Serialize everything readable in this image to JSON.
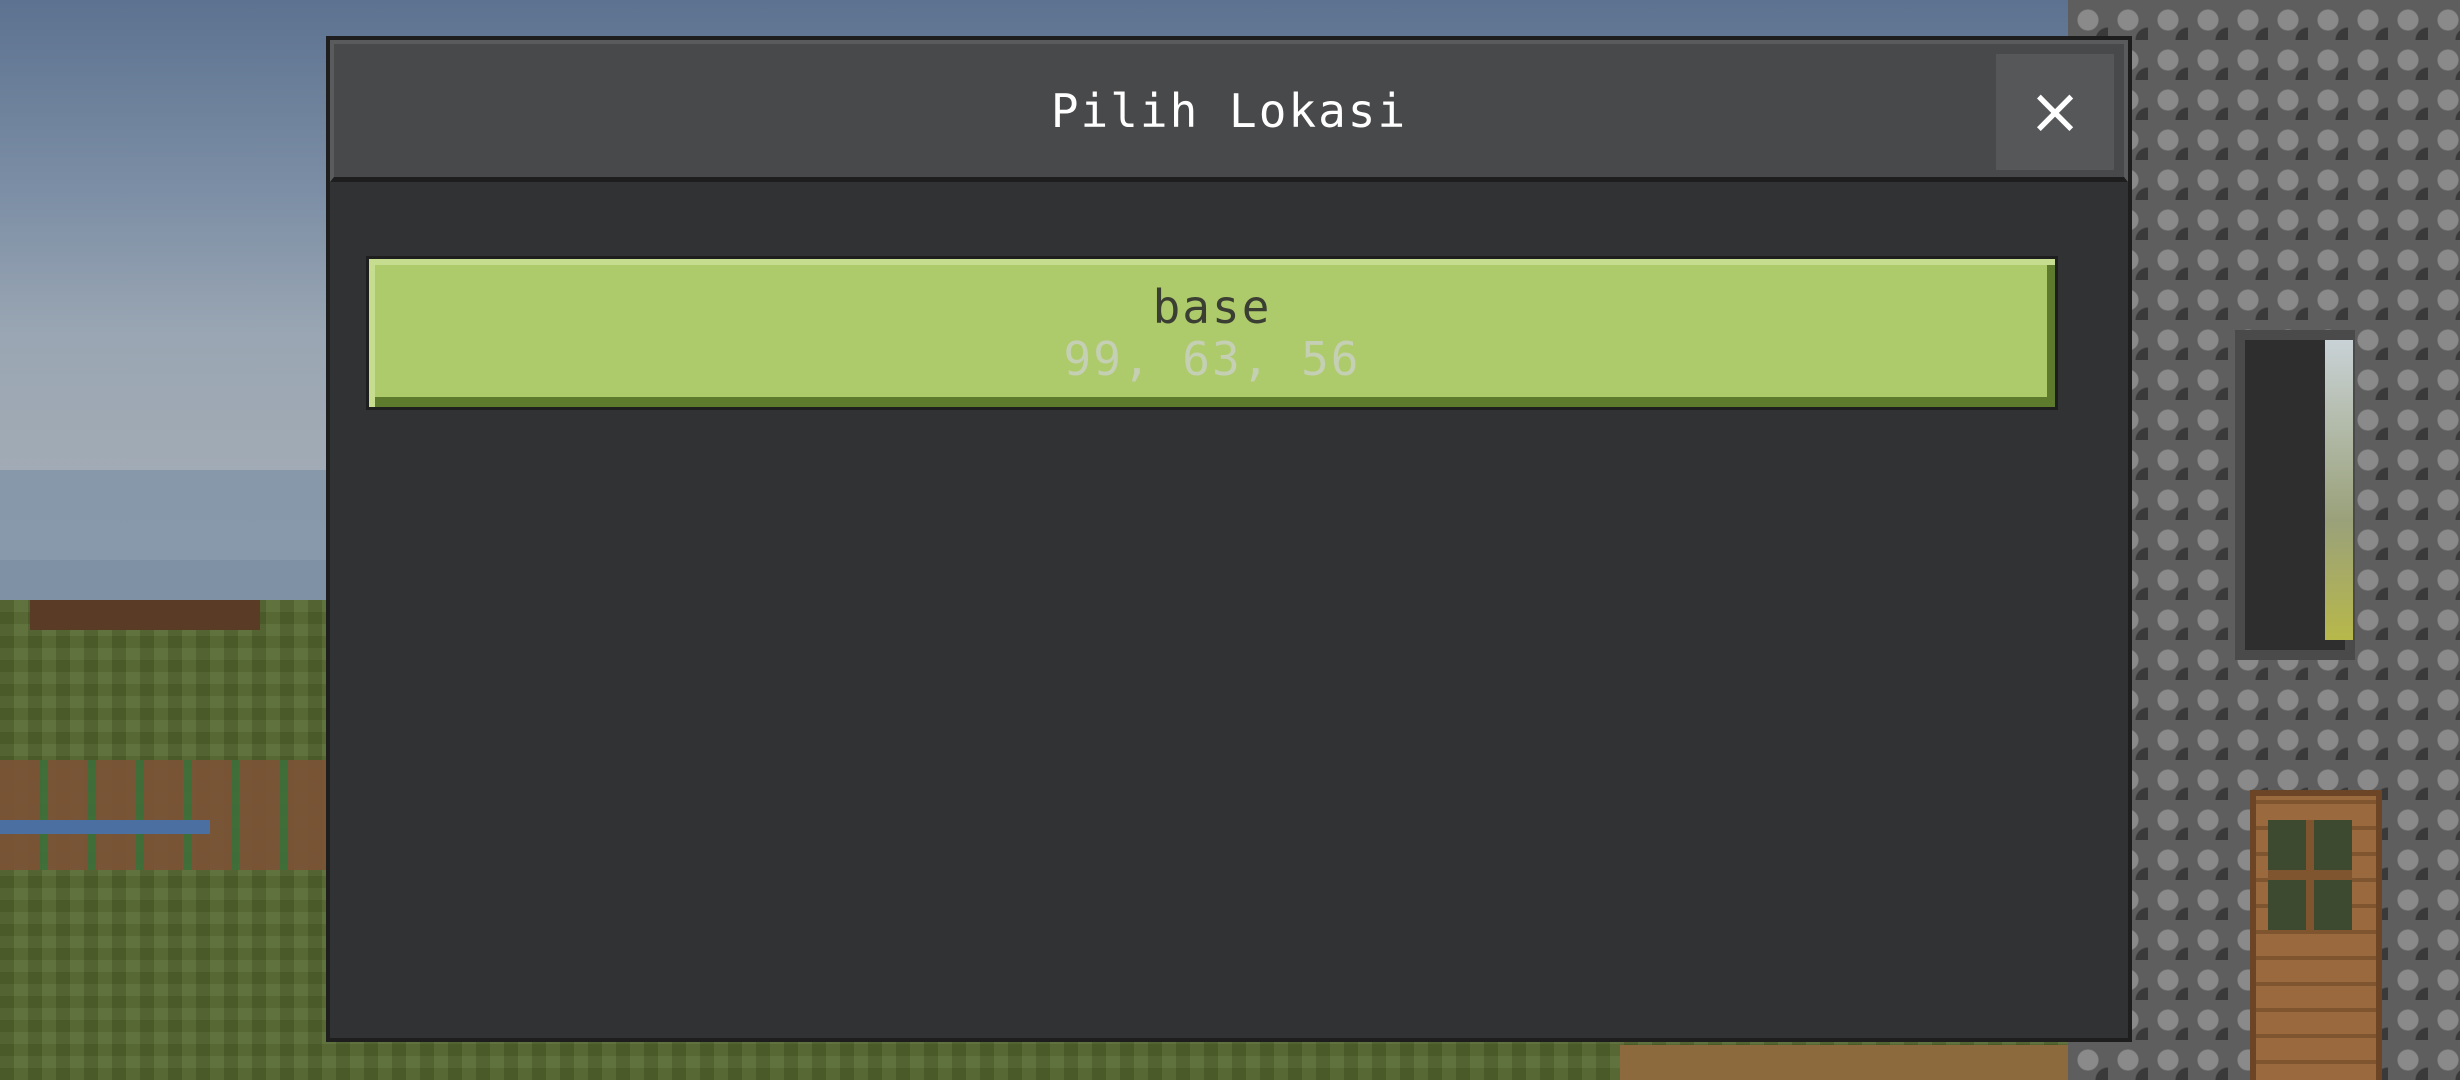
{
  "dialog": {
    "title": "Pilih Lokasi",
    "close_icon": "×"
  },
  "locations": [
    {
      "name": "base",
      "coords": "99, 63, 56"
    }
  ],
  "colors": {
    "item_background": "#aecb6b",
    "dialog_background": "#313233",
    "header_background": "#48494a"
  },
  "icons": {
    "close": "close-icon"
  }
}
